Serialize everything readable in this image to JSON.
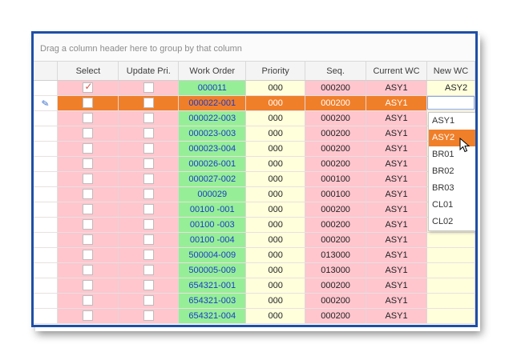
{
  "group_panel": {
    "hint": "Drag a column header here to group by that column"
  },
  "columns": {
    "select": "Select",
    "update_pri": "Update Pri.",
    "work_order": "Work Order",
    "priority": "Priority",
    "seq": "Seq.",
    "current_wc": "Current WC",
    "new_wc": "New WC"
  },
  "rows": [
    {
      "select": true,
      "work_order": "000011",
      "priority": "000",
      "seq": "000200",
      "current_wc": "ASY1",
      "new_wc": "ASY2"
    },
    {
      "select": false,
      "work_order": "000022-001",
      "priority": "000",
      "seq": "000200",
      "current_wc": "ASY1",
      "new_wc": ""
    },
    {
      "select": false,
      "work_order": "000022-003",
      "priority": "000",
      "seq": "000200",
      "current_wc": "ASY1",
      "new_wc": ""
    },
    {
      "select": false,
      "work_order": "000023-003",
      "priority": "000",
      "seq": "000200",
      "current_wc": "ASY1",
      "new_wc": ""
    },
    {
      "select": false,
      "work_order": "000023-004",
      "priority": "000",
      "seq": "000200",
      "current_wc": "ASY1",
      "new_wc": ""
    },
    {
      "select": false,
      "work_order": "000026-001",
      "priority": "000",
      "seq": "000200",
      "current_wc": "ASY1",
      "new_wc": ""
    },
    {
      "select": false,
      "work_order": "000027-002",
      "priority": "000",
      "seq": "000100",
      "current_wc": "ASY1",
      "new_wc": ""
    },
    {
      "select": false,
      "work_order": "000029",
      "priority": "000",
      "seq": "000100",
      "current_wc": "ASY1",
      "new_wc": ""
    },
    {
      "select": false,
      "work_order": "00100 -001",
      "priority": "000",
      "seq": "000200",
      "current_wc": "ASY1",
      "new_wc": ""
    },
    {
      "select": false,
      "work_order": "00100 -003",
      "priority": "000",
      "seq": "000200",
      "current_wc": "ASY1",
      "new_wc": ""
    },
    {
      "select": false,
      "work_order": "00100 -004",
      "priority": "000",
      "seq": "000200",
      "current_wc": "ASY1",
      "new_wc": ""
    },
    {
      "select": false,
      "work_order": "500004-009",
      "priority": "000",
      "seq": "013000",
      "current_wc": "ASY1",
      "new_wc": ""
    },
    {
      "select": false,
      "work_order": "500005-009",
      "priority": "000",
      "seq": "013000",
      "current_wc": "ASY1",
      "new_wc": ""
    },
    {
      "select": false,
      "work_order": "654321-001",
      "priority": "000",
      "seq": "000200",
      "current_wc": "ASY1",
      "new_wc": ""
    },
    {
      "select": false,
      "work_order": "654321-003",
      "priority": "000",
      "seq": "000200",
      "current_wc": "ASY1",
      "new_wc": ""
    },
    {
      "select": false,
      "work_order": "654321-004",
      "priority": "000",
      "seq": "000200",
      "current_wc": "ASY1",
      "new_wc": ""
    }
  ],
  "focused_row": 1,
  "edit_indicator_icon": "pencil-icon",
  "new_wc_dropdown": {
    "options": [
      "ASY1",
      "ASY2",
      "BR01",
      "BR02",
      "BR03",
      "CL01",
      "CL02"
    ],
    "highlighted": "ASY2"
  },
  "colors": {
    "frame_border": "#1f4fa6",
    "pink_cell": "#ffc6ce",
    "green_cell": "#96ee96",
    "yellow_cell": "#ffffdc",
    "focused_row": "#f07f2a",
    "work_order_text": "#1a3ccc"
  }
}
